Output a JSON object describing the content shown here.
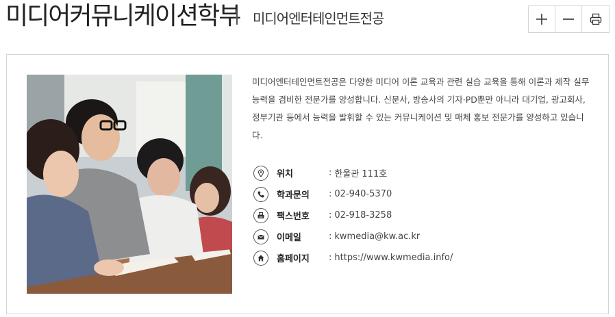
{
  "header": {
    "department": "미디어커뮤니케이션학부",
    "major": "미디어엔터테인먼트전공",
    "tools": [
      {
        "icon": "plus-icon"
      },
      {
        "icon": "minus-icon"
      },
      {
        "icon": "print-icon"
      }
    ]
  },
  "content": {
    "description": "미디어엔터테인먼트전공은 다양한 미디어 이론 교육과 관련 실습 교육을 통해 이론과 제작 실무 능력을 겸비한 전문가를 양성합니다. 신문사, 방송사의 기자·PD뿐만 아니라 대기업, 광고회사, 정부기관 등에서 능력을 발휘할 수 있는 커뮤니케이션 및 매체 홍보 전문가를 양성하고 있습니다.",
    "info": [
      {
        "icon": "location-icon",
        "label": "위치",
        "value": "한울관 111호"
      },
      {
        "icon": "phone-icon",
        "label": "학과문의",
        "value": "02-940-5370"
      },
      {
        "icon": "fax-icon",
        "label": "팩스번호",
        "value": "02-918-3258"
      },
      {
        "icon": "mail-icon",
        "label": "이메일",
        "value": "kwmedia@kw.ac.kr"
      },
      {
        "icon": "home-icon",
        "label": "홈페이지",
        "value": "https://www.kwmedia.info/"
      }
    ]
  },
  "colors": {
    "border": "#d4d4d4",
    "title": "#222222",
    "text": "#444444"
  }
}
